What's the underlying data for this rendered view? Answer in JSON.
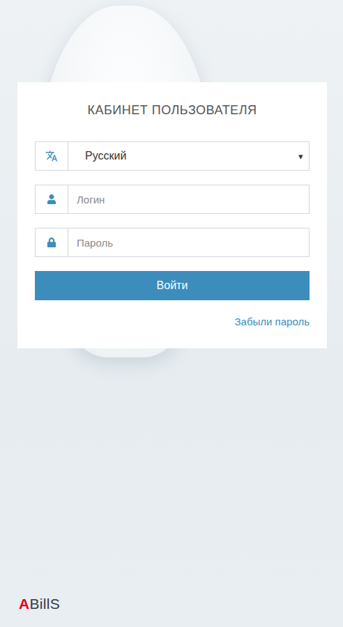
{
  "card": {
    "title": "КАБИНЕТ ПОЛЬЗОВАТЕЛЯ"
  },
  "language": {
    "value": "Русский",
    "arrow": "▾"
  },
  "fields": [
    {
      "kind": "text",
      "placeholder": "Логин"
    },
    {
      "kind": "password",
      "placeholder": "Пароль"
    }
  ],
  "login_button": "Войти",
  "forgot_link": "Забыли пароль",
  "logo": {
    "accent": "A",
    "rest": "BillS"
  }
}
